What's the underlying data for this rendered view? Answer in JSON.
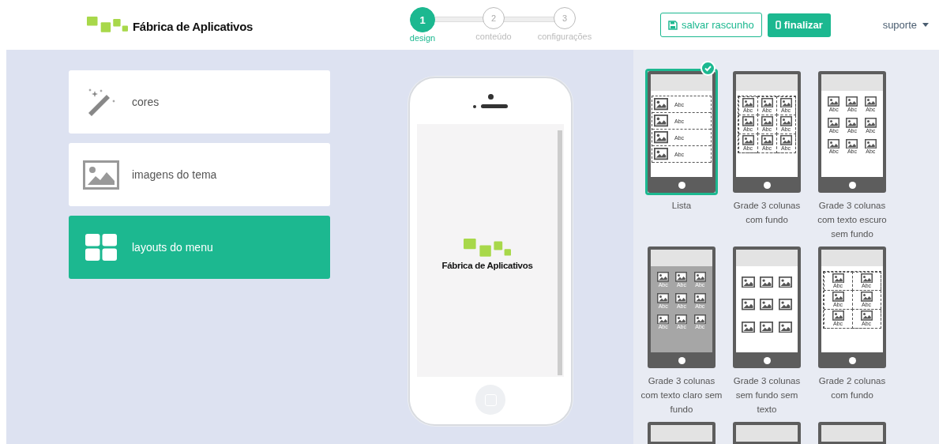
{
  "header": {
    "brand": "Fábrica de Aplicativos",
    "steps": [
      {
        "number": "1",
        "label": "design",
        "selected": true
      },
      {
        "number": "2",
        "label": "conteúdo",
        "selected": false
      },
      {
        "number": "3",
        "label": "configurações",
        "selected": false
      }
    ],
    "save_button": "salvar rascunho",
    "finish_button": "finalizar",
    "user_menu": "suporte"
  },
  "sidebar": {
    "items": [
      {
        "kind": "wand",
        "label": "cores",
        "selected": false
      },
      {
        "kind": "image",
        "label": "imagens do tema",
        "selected": false
      },
      {
        "kind": "grid",
        "label": "layouts do menu",
        "selected": true
      }
    ]
  },
  "preview": {
    "brand": "Fábrica de Aplicativos"
  },
  "layouts": [
    {
      "kind": "list",
      "label": "Lista",
      "selected": true,
      "cells": [
        "Abc",
        "Abc",
        "Abc",
        "Abc"
      ]
    },
    {
      "kind": "grid3-boxed",
      "label": "Grade 3 colunas com fundo",
      "selected": false,
      "cells": [
        "Abc",
        "Abc",
        "Abc",
        "Abc",
        "Abc",
        "Abc",
        "Abc",
        "Abc",
        "Abc"
      ]
    },
    {
      "kind": "grid3-plain",
      "label": "Grade 3 colunas com texto escuro sem fundo",
      "selected": false,
      "cells": [
        "Abc",
        "Abc",
        "Abc",
        "Abc",
        "Abc",
        "Abc",
        "Abc",
        "Abc",
        "Abc"
      ]
    },
    {
      "kind": "grid3-gray",
      "label": "Grade 3 colunas com texto claro sem fundo",
      "selected": false,
      "cells": [
        "Abc",
        "Abc",
        "Abc",
        "Abc",
        "Abc",
        "Abc",
        "Abc",
        "Abc",
        "Abc"
      ]
    },
    {
      "kind": "grid3-notext",
      "label": "Grade 3 colunas sem fundo sem texto",
      "selected": false
    },
    {
      "kind": "grid2-boxed",
      "label": "Grade 2 colunas com fundo",
      "selected": false,
      "cells": [
        "Abc",
        "Abc",
        "Abc",
        "Abc",
        "Abc",
        "Abc"
      ]
    },
    {
      "kind": "cut",
      "selected": false
    },
    {
      "kind": "cut",
      "selected": false
    },
    {
      "kind": "cut",
      "selected": false
    }
  ]
}
